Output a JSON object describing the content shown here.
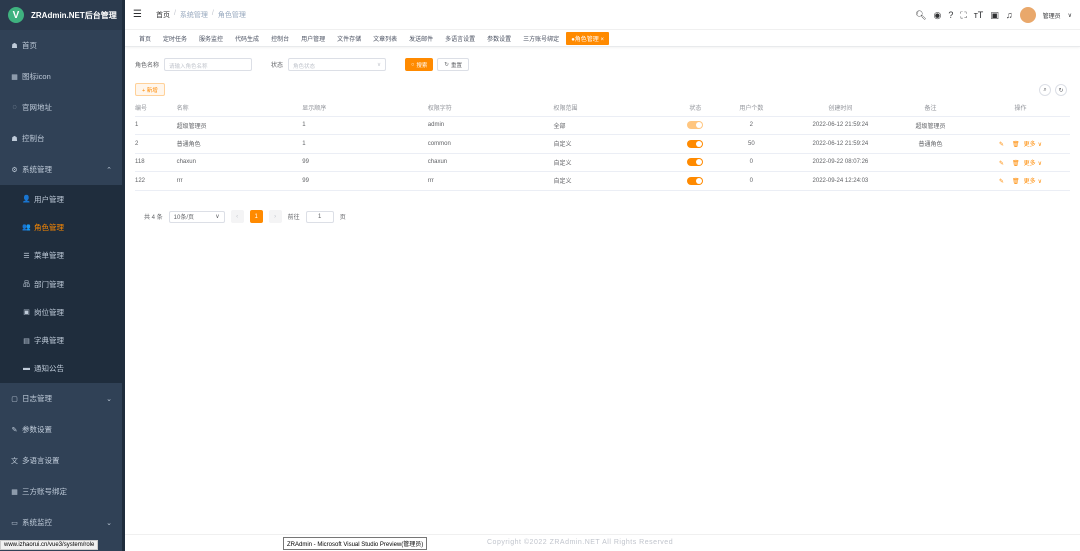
{
  "app": {
    "logo_letter": "V",
    "title": "ZRAdmin.NET后台管理"
  },
  "sidebar": {
    "items": [
      {
        "icon": "dashboard-icon",
        "glyph": "☗",
        "label": "首页"
      },
      {
        "icon": "grid-icon",
        "glyph": "▦",
        "label": "图标icon"
      },
      {
        "icon": "link-icon",
        "glyph": "◌",
        "label": "官网地址"
      },
      {
        "icon": "dashboard-icon",
        "glyph": "☗",
        "label": "控制台"
      },
      {
        "icon": "gear-icon",
        "glyph": "⚙",
        "label": "系统管理",
        "chevron": "⌃"
      }
    ],
    "sub_items": [
      {
        "icon": "user-icon",
        "glyph": "👤",
        "label": "用户管理"
      },
      {
        "icon": "role-icon",
        "glyph": "👥",
        "label": "角色管理",
        "active": true
      },
      {
        "icon": "menu-tree-icon",
        "glyph": "☰",
        "label": "菜单管理"
      },
      {
        "icon": "org-icon",
        "glyph": "品",
        "label": "部门管理"
      },
      {
        "icon": "post-icon",
        "glyph": "▣",
        "label": "岗位管理"
      },
      {
        "icon": "dict-icon",
        "glyph": "▤",
        "label": "字典管理"
      },
      {
        "icon": "notice-icon",
        "glyph": "▬",
        "label": "通知公告"
      }
    ],
    "items2": [
      {
        "icon": "log-icon",
        "glyph": "▢",
        "label": "日志管理",
        "chevron": "⌄"
      },
      {
        "icon": "edit-icon",
        "glyph": "✎",
        "label": "参数设置"
      },
      {
        "icon": "language-icon",
        "glyph": "文",
        "label": "多语言设置"
      },
      {
        "icon": "grid-icon",
        "glyph": "▦",
        "label": "三方账号绑定"
      },
      {
        "icon": "monitor-icon",
        "glyph": "▭",
        "label": "系统监控",
        "chevron": "⌄"
      }
    ]
  },
  "header": {
    "breadcrumb": [
      "首页",
      "系统管理",
      "角色管理"
    ],
    "username": "管理员"
  },
  "tags": [
    "首页",
    "定时任务",
    "服务监控",
    "代码生成",
    "控制台",
    "用户管理",
    "文件存储",
    "文章列表",
    "发送邮件",
    "多语言设置",
    "参数设置",
    "三方账号绑定",
    "●角色管理 ×"
  ],
  "search": {
    "role_name_label": "角色名称",
    "role_name_placeholder": "请输入角色名称",
    "status_label": "状态",
    "status_placeholder": "角色状态",
    "search_button": "搜索",
    "reset_button": "重置",
    "add_button": "+ 新增"
  },
  "table": {
    "columns": [
      "编号",
      "名称",
      "显示顺序",
      "权限字符",
      "权限范围",
      "状态",
      "用户个数",
      "创建时间",
      "备注",
      "操作"
    ],
    "rows": [
      {
        "id": "1",
        "name": "超级管理员",
        "order": "1",
        "key": "admin",
        "scope": "全部",
        "status": true,
        "users": "2",
        "created": "2022-06-12 21:59:24",
        "remark": "超级管理员",
        "ops": false
      },
      {
        "id": "2",
        "name": "普通角色",
        "order": "1",
        "key": "common",
        "scope": "自定义",
        "status": true,
        "users": "50",
        "created": "2022-06-12 21:59:24",
        "remark": "普通角色",
        "ops": true
      },
      {
        "id": "118",
        "name": "chaxun",
        "order": "99",
        "key": "chaxun",
        "scope": "自定义",
        "status": true,
        "users": "0",
        "created": "2022-09-22 08:07:26",
        "remark": "",
        "ops": true
      },
      {
        "id": "122",
        "name": "rrr",
        "order": "99",
        "key": "rrr",
        "scope": "自定义",
        "status": true,
        "users": "0",
        "created": "2022-09-24 12:24:03",
        "remark": "",
        "ops": true
      }
    ],
    "more_label": "更多"
  },
  "pager": {
    "total": "共 4 条",
    "page_size": "10条/页",
    "current": "1",
    "goto_label": "前往",
    "goto_value": "1",
    "page_unit": "页"
  },
  "footer": {
    "copyright": "Copyright ©2022 ZRAdmin.NET All Rights Reserved"
  },
  "tooltip": "ZRAdmin - Microsoft Visual Studio Preview(管理员)",
  "status_url": "www.izhaorui.cn/vue3/system/role",
  "colors": {
    "accent": "#ff8a00",
    "sidebar_bg": "#304156"
  }
}
